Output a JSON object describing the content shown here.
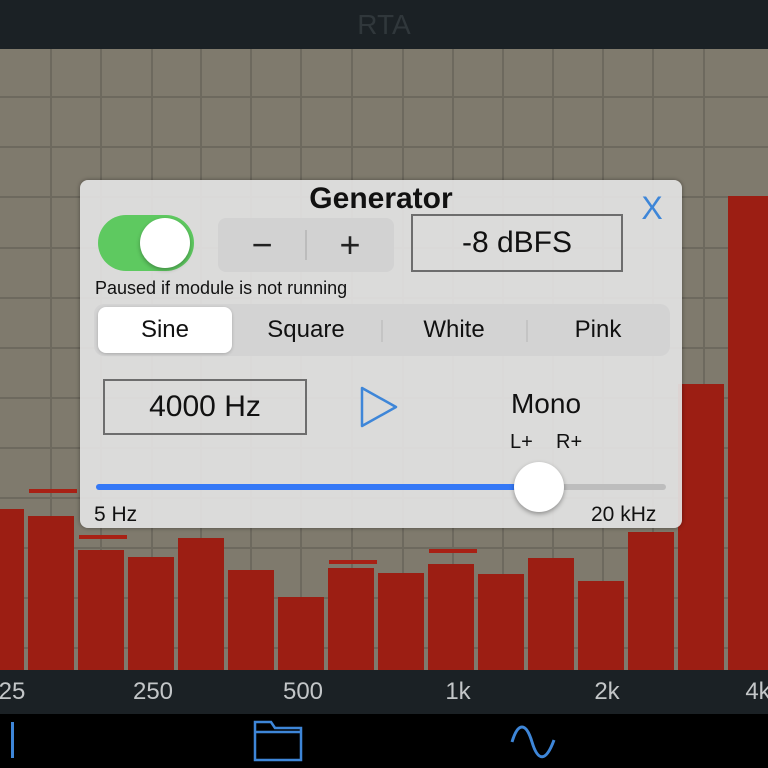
{
  "app": {
    "title": "RTA"
  },
  "spectrum": {
    "bar_heights_dbfs_frac": [
      0.26,
      0.248,
      0.193,
      0.182,
      0.212,
      0.161,
      0.117,
      0.164,
      0.157,
      0.171,
      0.154,
      0.18,
      0.144,
      0.223,
      0.46,
      0.764
    ],
    "axis_labels": [
      "25",
      "250",
      "500",
      "1k",
      "2k",
      "4k"
    ],
    "bar_color": "#9c1e13",
    "grid_color": "#6d695e",
    "background_color": "#7f7a6d"
  },
  "generator": {
    "title": "Generator",
    "close_label": "X",
    "enabled": true,
    "stepper_minus": "−",
    "stepper_plus": "+",
    "level": "-8 dBFS",
    "paused_note": "Paused if module is not running",
    "waveforms": [
      "Sine",
      "Square",
      "White",
      "Pink"
    ],
    "selected_waveform": "Sine",
    "frequency": "4000 Hz",
    "channel_mode": "Mono",
    "left_channel": "L+",
    "right_channel": "R+",
    "slider_min_label": "5 Hz",
    "slider_max_label": "20 kHz",
    "slider_fraction": 0.778,
    "accent_color": "#3478f6",
    "toggle_on_color": "#5ec960"
  },
  "toolbar": {
    "icons": [
      "cursor-icon",
      "folder-icon",
      "sine-wave-icon"
    ]
  }
}
